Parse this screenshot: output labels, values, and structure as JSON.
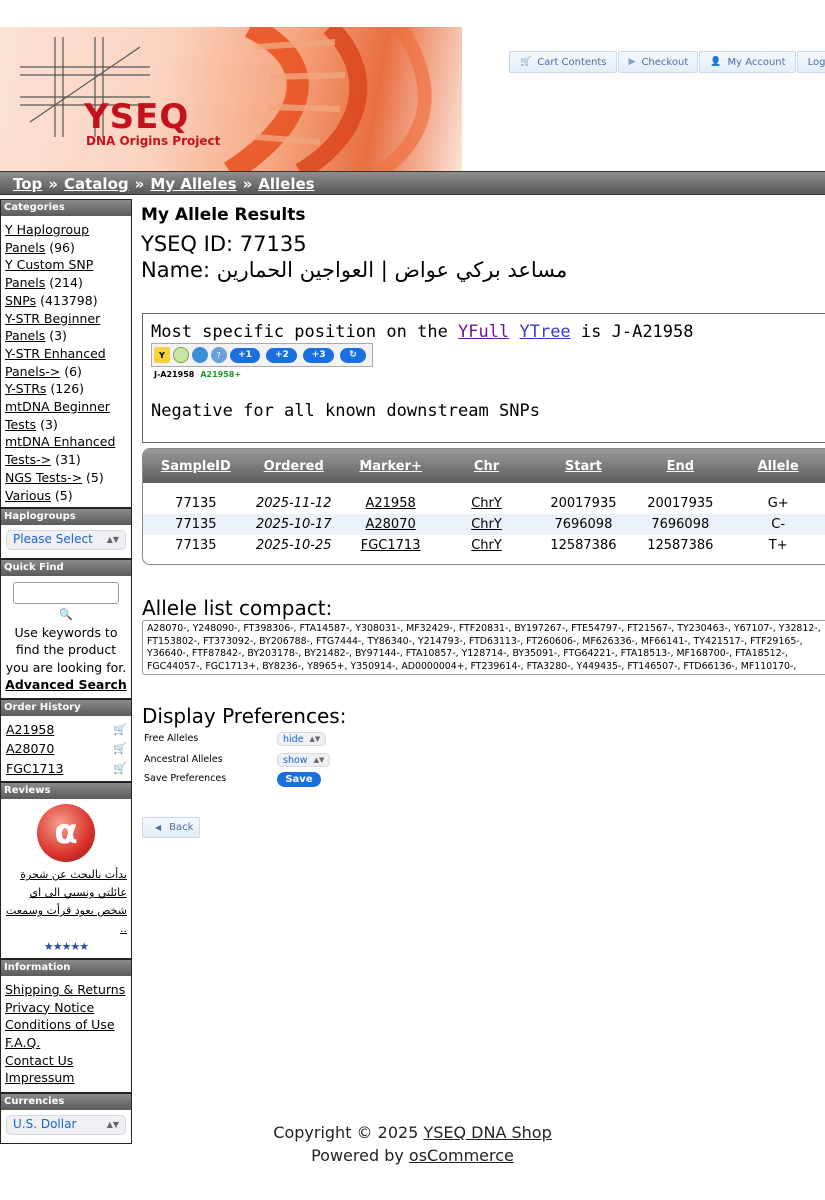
{
  "header": {
    "logo_text": "YSEQ",
    "logo_sub": "DNA Origins Project",
    "nav": [
      {
        "label": "Cart Contents",
        "icon": "cart-icon"
      },
      {
        "label": "Checkout",
        "icon": "chevron-right-icon"
      },
      {
        "label": "My Account",
        "icon": "person-icon"
      },
      {
        "label": "Log Off",
        "icon": "logoff-icon"
      }
    ]
  },
  "breadcrumb": [
    "Top",
    "Catalog",
    "My Alleles",
    "Alleles"
  ],
  "sidebar": {
    "categories_title": "Categories",
    "categories": [
      {
        "name": "Y Haplogroup Panels",
        "count": "(96)"
      },
      {
        "name": "Y Custom SNP Panels",
        "count": "(214)"
      },
      {
        "name": "SNPs",
        "count": "(413798)"
      },
      {
        "name": "Y-STR Beginner Panels",
        "count": "(3)"
      },
      {
        "name": "Y-STR Enhanced Panels->",
        "count": "(6)"
      },
      {
        "name": "Y-STRs",
        "count": "(126)"
      },
      {
        "name": "mtDNA Beginner Tests",
        "count": "(3)"
      },
      {
        "name": "mtDNA Enhanced Tests->",
        "count": "(31)"
      },
      {
        "name": "NGS Tests->",
        "count": "(5)"
      },
      {
        "name": "Various",
        "count": "(5)"
      }
    ],
    "haplogroups_title": "Haplogroups",
    "haplogroups_select": "Please Select",
    "quickfind_title": "Quick Find",
    "quickfind_text": "Use keywords to find the product you are looking for.",
    "advanced_search": "Advanced Search",
    "order_history_title": "Order History",
    "order_history": [
      "A21958",
      "A28070",
      "FGC1713"
    ],
    "reviews_title": "Reviews",
    "review_text": "بدأت بالبحث عن شجرة عائلتي ونسبي الى اي شخص يعود قرأت وسمعت ..",
    "review_stars": "★★★★★",
    "information_title": "Information",
    "information": [
      "Shipping & Returns",
      "Privacy Notice",
      "Conditions of Use",
      "F.A.Q.",
      "Contact Us",
      "Impressum"
    ],
    "currencies_title": "Currencies",
    "currency_select": "U.S. Dollar"
  },
  "main": {
    "title": "My Allele Results",
    "yseq_id": "YSEQ ID: 77135",
    "name_line": "Name: مساعد بركي عواض | العواجين الحمارين",
    "yfull": {
      "prefix": "Most specific position on the ",
      "link1": "YFull",
      "link2": "YTree",
      "suffix": " is J-A21958",
      "buttons": [
        "+1",
        "+2",
        "+3",
        "↻"
      ],
      "clade": "J-A21958",
      "clade_snp": "A21958+",
      "negative": "Negative for all known downstream SNPs"
    },
    "table": {
      "headers": [
        "SampleID",
        "Ordered",
        "Marker+",
        "Chr",
        "Start",
        "End",
        "Allele"
      ],
      "rows": [
        [
          "77135",
          "2025-11-12",
          "A21958",
          "ChrY",
          "20017935",
          "20017935",
          "G+"
        ],
        [
          "77135",
          "2025-10-17",
          "A28070",
          "ChrY",
          "7696098",
          "7696098",
          "C-"
        ],
        [
          "77135",
          "2025-10-25",
          "FGC1713",
          "ChrY",
          "12587386",
          "12587386",
          "T+"
        ]
      ]
    },
    "compact_title": "Allele list compact:",
    "compact_text": "A28070-, Y248090-, FT398306-, FTA14587-, Y308031-, MF32429-, FTF20831-, BY197267-, FTE54797-, FT21567-, TY230463-, Y67107-, Y32812-, FT153802-, FT373092-, BY206788-, FTG7444-, TY86340-, Y214793-, FTD63113-, FT260606-, MF626336-, MF66141-, TY421517-, FTF29165-, Y36640-, FTF87842-, BY203178-, BY21482-, BY97144-, FTA10857-, Y128714-, BY35091-, FTG64221-, FTA18513-, MF168700-, FTA18512-, FGC44057-, FGC1713+, BY8236-, Y8965+, Y350914-, AD0000004+, FT239614-, FTA3280-, Y449435-, FT146507-, FTD66136-, MF110170-,",
    "prefs_title": "Display Preferences:",
    "pref_free": "Free Alleles",
    "pref_free_value": "hide",
    "pref_ancestral": "Ancestral Alleles",
    "pref_ancestral_value": "show",
    "pref_save": "Save Preferences",
    "save_label": "Save",
    "back_label": "Back"
  },
  "footer": {
    "copyright": "Copyright © 2025 ",
    "shop": "YSEQ DNA Shop",
    "powered": "Powered by ",
    "oscommerce": "osCommerce"
  },
  "colors": {
    "accent": "#1a6fe0",
    "logo": "#c4121d",
    "bar": "#5c5c5c"
  }
}
